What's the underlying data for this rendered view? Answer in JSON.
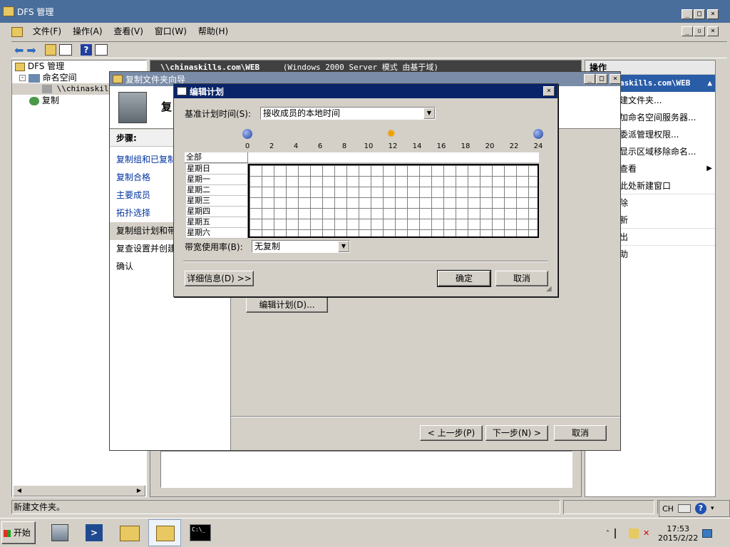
{
  "main_window": {
    "title": "DFS 管理",
    "menu": [
      "文件(F)",
      "操作(A)",
      "查看(V)",
      "窗口(W)",
      "帮助(H)"
    ],
    "status": "新建文件夹。",
    "status_lang": "CH"
  },
  "tree": {
    "root": "DFS 管理",
    "namespaces": "命名空间",
    "namespace_item": "\\\\chinaskill",
    "replication": "复制"
  },
  "center_header": {
    "path": "\\\\chinaskills.com\\WEB",
    "mode": "(Windows 2000 Server 模式 由基于域)"
  },
  "actions_pane": {
    "header": "操作",
    "selected": "askills.com\\WEB",
    "items": [
      "建文件夹...",
      "加命名空间服务器...",
      "委派管理权限...",
      "显示区域移除命名...",
      "查看",
      "此处新建窗口",
      "除",
      "新",
      "出",
      "助"
    ]
  },
  "wizard": {
    "title": "复制文件夹向导",
    "header_text": "复",
    "steps_label": "步骤:",
    "steps": [
      "复制组和已复制",
      "复制合格",
      "主要成员",
      "拓扑选择",
      "复制组计划和带",
      "复查设置并创建",
      "确认"
    ],
    "edit_schedule_button": "编辑计划(D)...",
    "prev_button": "< 上一步(P)",
    "next_button": "下一步(N) >",
    "cancel_button": "取消"
  },
  "schedule_dialog": {
    "title": "编辑计划",
    "base_time_label": "基准计划时间(S):",
    "base_time_value": "接收成员的本地时间",
    "hours": [
      "0",
      "2",
      "4",
      "6",
      "8",
      "10",
      "12",
      "14",
      "16",
      "18",
      "20",
      "22",
      "24"
    ],
    "all_label": "全部",
    "days": [
      "星期日",
      "星期一",
      "星期二",
      "星期三",
      "星期四",
      "星期五",
      "星期六"
    ],
    "bandwidth_label": "带宽使用率(B):",
    "bandwidth_value": "无复制",
    "details_button": "详细信息(D) >>",
    "ok_button": "确定",
    "cancel_button": "取消"
  },
  "taskbar": {
    "start": "开始",
    "time": "17:53",
    "date": "2015/2/22",
    "cmd_text": "C:\\_"
  },
  "colors": {
    "title_active": "#0a246a",
    "title_inactive": "#4a6e9c",
    "link": "#0033a0",
    "face": "#d4d0c8"
  }
}
